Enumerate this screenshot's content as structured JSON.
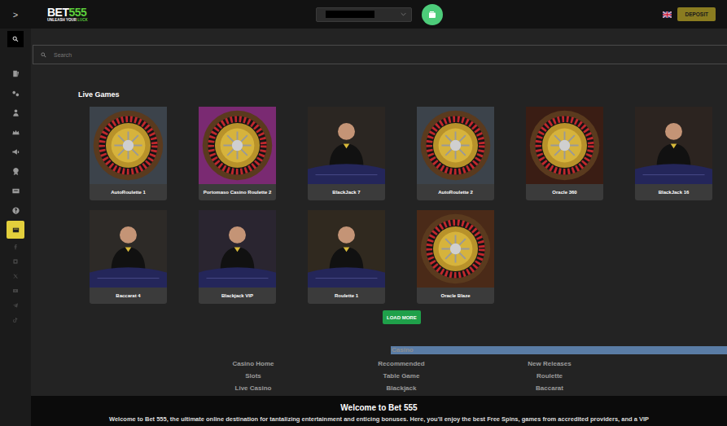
{
  "header": {
    "toggle": ">",
    "logo": {
      "brand": "BET",
      "number": "555",
      "tagline": "UNLEASH YOUR",
      "tagline_accent": "LUCK"
    },
    "deposit": "DEPOSIT"
  },
  "sidebar": {
    "items": [
      {
        "kind": "search",
        "highlighted": false
      },
      {
        "kind": "nav",
        "highlighted": false
      },
      {
        "kind": "nav",
        "highlighted": false
      },
      {
        "kind": "nav",
        "highlighted": false
      },
      {
        "kind": "nav",
        "highlighted": false
      },
      {
        "kind": "nav",
        "highlighted": false
      },
      {
        "kind": "nav",
        "highlighted": false
      },
      {
        "kind": "nav",
        "highlighted": false
      },
      {
        "kind": "nav",
        "highlighted": false
      },
      {
        "kind": "nav",
        "highlighted": true
      },
      {
        "kind": "social",
        "highlighted": false
      },
      {
        "kind": "social",
        "highlighted": false
      },
      {
        "kind": "social",
        "highlighted": false
      },
      {
        "kind": "social",
        "highlighted": false
      },
      {
        "kind": "social",
        "highlighted": false
      },
      {
        "kind": "social",
        "highlighted": false
      }
    ]
  },
  "search": {
    "placeholder": "Search"
  },
  "section": {
    "title": "Live Games"
  },
  "games": [
    {
      "name": "AutoRoulette 1",
      "kind": "roulette",
      "color": "#3c434b"
    },
    {
      "name": "Portomaso Casino Roulette 2",
      "kind": "roulette",
      "color": "#7a2a72"
    },
    {
      "name": "BlackJack 7",
      "kind": "dealer",
      "color": "#2b2622"
    },
    {
      "name": "AutoRoulette 2",
      "kind": "roulette",
      "color": "#3c434b"
    },
    {
      "name": "Oracle 360",
      "kind": "roulette",
      "color": "#3a1d14"
    },
    {
      "name": "BlackJack 16",
      "kind": "dealer",
      "color": "#2c2420"
    },
    {
      "name": "Baccarat 4",
      "kind": "dealer",
      "color": "#2d2a27"
    },
    {
      "name": "Blackjack VIP",
      "kind": "dealer",
      "color": "#2a2530"
    },
    {
      "name": "Roulette 1",
      "kind": "dealer",
      "color": "#30291f"
    },
    {
      "name": "Oracle Blaze",
      "kind": "roulette",
      "color": "#4a2a18"
    }
  ],
  "load_more": "LOAD MORE",
  "footer_nav": {
    "title": "Casino",
    "columns": [
      [
        "Casino Home",
        "Slots",
        "Live Casino"
      ],
      [
        "Recommended",
        "Table Game",
        "Blackjack"
      ],
      [
        "New Releases",
        "Roulette",
        "Baccarat"
      ]
    ]
  },
  "welcome": {
    "title": "Welcome to Bet 555",
    "text": "Welcome to Bet 555, the ultimate online destination for tantalizing entertainment and enticing bonuses. Here, you'll enjoy the best Free Spins, games from accredited providers, and a VIP"
  }
}
